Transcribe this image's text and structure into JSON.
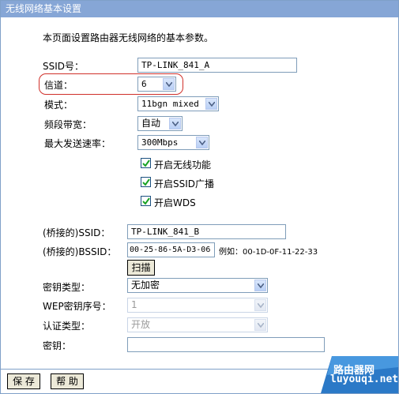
{
  "window": {
    "title": "无线网络基本设置"
  },
  "intro": "本页面设置路由器无线网络的基本参数。",
  "fields": {
    "ssid": {
      "label": "SSID号：",
      "value": "TP-LINK_841_A"
    },
    "channel": {
      "label": "信道：",
      "value": "6"
    },
    "mode": {
      "label": "模式：",
      "value": "11bgn mixed"
    },
    "bandwidth": {
      "label": "频段带宽：",
      "value": "自动"
    },
    "max_rate": {
      "label": "最大发送速率：",
      "value": "300Mbps"
    }
  },
  "checkboxes": [
    {
      "label": "开启无线功能",
      "checked": true
    },
    {
      "label": "开启SSID广播",
      "checked": true
    },
    {
      "label": "开启WDS",
      "checked": true
    }
  ],
  "wds": {
    "bridged_ssid": {
      "label": "(桥接的)SSID：",
      "value": "TP-LINK_841_B"
    },
    "bridged_bssid": {
      "label": "(桥接的)BSSID：",
      "value": "00-25-86-5A-D3-06",
      "example": "例如：00-1D-0F-11-22-33"
    },
    "scan_label": "扫描",
    "key_type": {
      "label": "密钥类型：",
      "value": "无加密"
    },
    "wep_index": {
      "label": "WEP密钥序号：",
      "value": "1"
    },
    "auth_type": {
      "label": "认证类型：",
      "value": "开放"
    },
    "key": {
      "label": "密钥：",
      "value": ""
    }
  },
  "buttons": {
    "save": "保 存",
    "help": "帮 助"
  },
  "watermark": {
    "line1": "路由器网",
    "line2": "luyouqi.net"
  },
  "colors": {
    "titlebar": "#86a6d6",
    "highlight": "#d0302a",
    "check": "#1aa324"
  }
}
